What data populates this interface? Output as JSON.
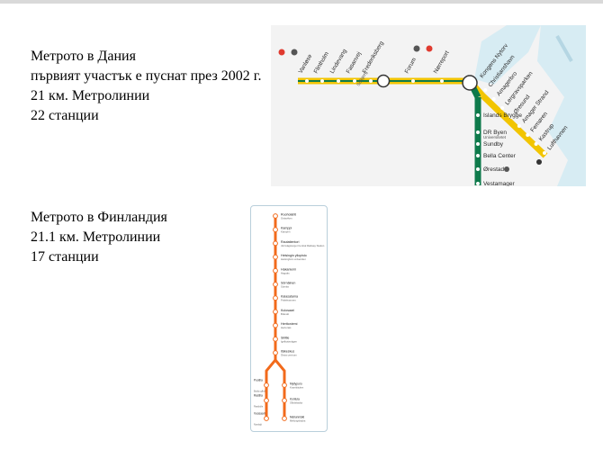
{
  "slide": {
    "denmark": {
      "lines": [
        "Метрото в Дания",
        "първият участък е пуснат през 2002 г.",
        "21 км. Метролинии",
        "22 станции"
      ]
    },
    "finland": {
      "lines": [
        "Метрото в Финландия",
        "21.1 км. Метролинии",
        "17 станции"
      ]
    }
  },
  "maps": {
    "denmark": {
      "colors": {
        "yellow": "#f2c500",
        "green": "#0e7a4b",
        "water": "#d7ecf3",
        "land": "#f3f3f3",
        "red": "#e03a2f"
      },
      "west_stations": [
        "Vanløse",
        "Flintholm",
        "Lindevang",
        "Fasanvej",
        "Frederiksberg",
        "Forum",
        "Nørreport"
      ],
      "branch_stations": [
        "Kongens Nytorv",
        "Christianshavn",
        "Amagerbro",
        "Lergravsparken",
        "Øresund",
        "Amager Strand",
        "Femøren",
        "Kastrup",
        "Lufthavnen"
      ],
      "south_stations": [
        "Islands Brygge",
        "DR Byen",
        "Sundby",
        "Bella Center",
        "Ørestad",
        "Vestamager"
      ],
      "subtitles": {
        "fasanvej": "Solbjerg",
        "dr_byen": "Universitetet",
        "kastrup": "Lufthavnen"
      }
    },
    "finland": {
      "line_color": "#f26a1b",
      "trunk_stations": [
        {
          "name": "Ruoholahti",
          "sub": "Gräsviken"
        },
        {
          "name": "Kamppi",
          "sub": "Kampen"
        },
        {
          "name": "Rautatientori",
          "sub": "Järnvägstorget Central Railway Station"
        },
        {
          "name": "Helsingin yliopisto",
          "sub": "Helsingfors universitet"
        },
        {
          "name": "Hakaniemi",
          "sub": "Hagnäs"
        },
        {
          "name": "Sörnäinen",
          "sub": "Sörnäs"
        },
        {
          "name": "Kalasatama",
          "sub": "Fiskehamnen"
        },
        {
          "name": "Kulosaari",
          "sub": "Brändö"
        },
        {
          "name": "Herttoniemi",
          "sub": "Hertonäs"
        },
        {
          "name": "Siilitie",
          "sub": "Igelkottsvägen"
        },
        {
          "name": "Itäkeskus",
          "sub": "Östra centrum"
        }
      ],
      "left_stations": [
        {
          "name": "Puotila",
          "sub": "Botby gård"
        },
        {
          "name": "Rastila",
          "sub": "Rastböle"
        },
        {
          "name": "Vuosaari",
          "sub": "Nordsjö"
        }
      ],
      "right_stations": [
        {
          "name": "Myllypuro",
          "sub": "Kvarnbäcken"
        },
        {
          "name": "Kontula",
          "sub": "Gårdsbacka"
        },
        {
          "name": "Mellunmäki",
          "sub": "Mellungsbacka"
        }
      ]
    }
  }
}
